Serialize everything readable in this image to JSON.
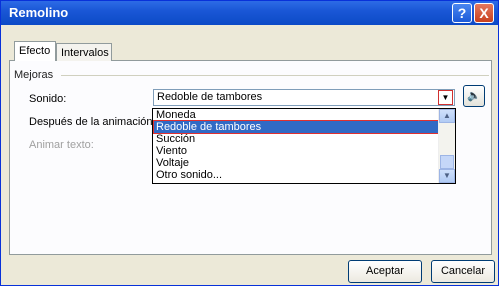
{
  "window": {
    "title": "Remolino",
    "help_label": "?",
    "close_label": "X"
  },
  "tabs": [
    {
      "label": "Efecto"
    },
    {
      "label": "Intervalos"
    }
  ],
  "group": {
    "label": "Mejoras"
  },
  "form": {
    "sound_label": "Sonido:",
    "after_label": "Después de la animación:",
    "animate_label": "Animar texto:",
    "sound_value": "Redoble de tambores"
  },
  "sound_list": [
    "Moneda",
    "Redoble de tambores",
    "Succión",
    "Viento",
    "Voltaje",
    "Otro sonido..."
  ],
  "selected_index": 1,
  "buttons": {
    "ok": "Aceptar",
    "cancel": "Cancelar"
  },
  "icons": {
    "dropdown": "chevron-down-icon",
    "speaker": "speaker-icon",
    "scroll_up": "chevron-up-icon",
    "scroll_down": "chevron-down-icon"
  }
}
